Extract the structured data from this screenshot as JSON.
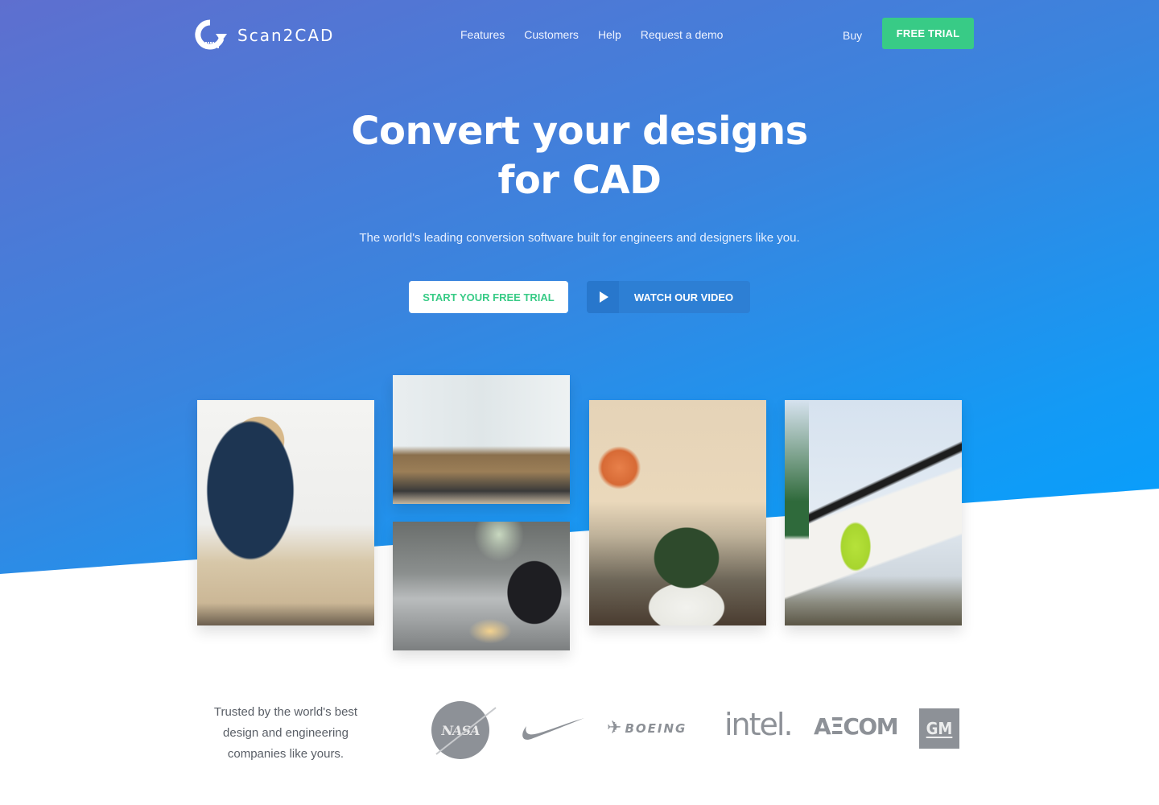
{
  "brand": {
    "name": "Scan2CAD",
    "logo_icon": "scan-arrow-logo-icon",
    "accent_green": "#38cb86",
    "hero_gradient": [
      "#5e6fcf",
      "#04a0fe"
    ]
  },
  "nav": {
    "links": [
      {
        "label": "Features"
      },
      {
        "label": "Customers"
      },
      {
        "label": "Help"
      },
      {
        "label": "Request a demo"
      }
    ],
    "buy_label": "Buy",
    "cta_label": "FREE TRIAL"
  },
  "hero": {
    "title_line1": "Convert your designs",
    "title_line2": "for CAD",
    "subtitle": "The world's leading conversion software built for engineers and designers like you.",
    "primary_button": "START YOUR FREE TRIAL",
    "secondary_button": "WATCH OUR VIDEO",
    "secondary_icon": "play-icon"
  },
  "photos": [
    {
      "alt": "Woman designer working on drawings at desk"
    },
    {
      "alt": "Open plan office with people at computers"
    },
    {
      "alt": "Engineer operating CNC plasma cutting machine"
    },
    {
      "alt": "Two men reviewing architectural blueprints"
    },
    {
      "alt": "Construction worker guiding crane-lifted panel"
    }
  ],
  "trust": {
    "text_line1": "Trusted by the world's best",
    "text_line2": "design and engineering",
    "text_line3": "companies like yours.",
    "logos": [
      {
        "name": "NASA",
        "text": "NASA"
      },
      {
        "name": "Nike",
        "text": ""
      },
      {
        "name": "Boeing",
        "text": "BOEING"
      },
      {
        "name": "Intel",
        "text": "intel."
      },
      {
        "name": "AECOM",
        "text": "AΞCOM"
      },
      {
        "name": "GM",
        "text": "GM"
      }
    ]
  }
}
